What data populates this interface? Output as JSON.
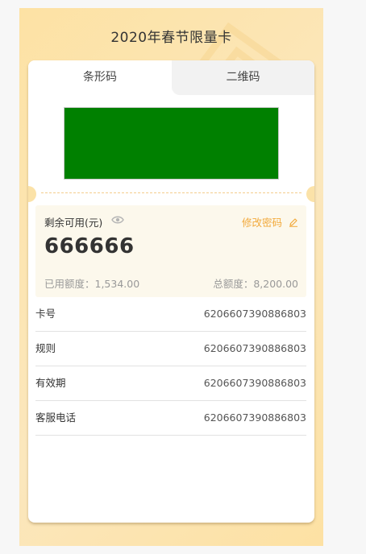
{
  "page": {
    "title": "2020年春节限量卡"
  },
  "tabs": [
    {
      "label": "条形码",
      "active": true
    },
    {
      "label": "二维码",
      "active": false
    }
  ],
  "barcode": {
    "color": "#008000"
  },
  "balance": {
    "label": "剩余可用(元)",
    "amount": "666666",
    "change_password": "修改密码",
    "used": "已用额度：1,534.00",
    "total": "总额度：8,200.00"
  },
  "info": [
    {
      "label": "卡号",
      "value": "6206607390886803"
    },
    {
      "label": "规则",
      "value": "6206607390886803"
    },
    {
      "label": "有效期",
      "value": "6206607390886803"
    },
    {
      "label": "客服电话",
      "value": "6206607390886803"
    }
  ],
  "colors": {
    "accent": "#f2a93b",
    "background_gold": "#fde2a4"
  },
  "icons": [
    "eye-icon",
    "edit-icon"
  ]
}
